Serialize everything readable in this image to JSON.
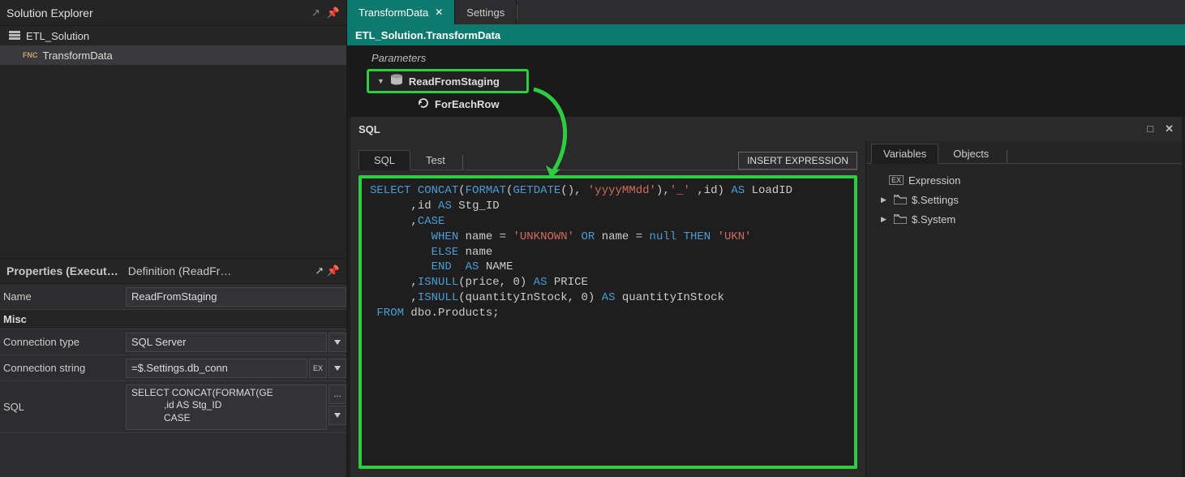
{
  "solutionExplorer": {
    "title": "Solution Explorer",
    "root": {
      "label": "ETL_Solution"
    },
    "item": {
      "badge": "FNC",
      "label": "TransformData"
    }
  },
  "properties": {
    "tab1": "Properties (Execut…",
    "tab2": "Definition (ReadFr…",
    "nameLabel": "Name",
    "nameValue": "ReadFromStaging",
    "catMisc": "Misc",
    "connTypeLabel": "Connection type",
    "connTypeValue": "SQL Server",
    "connStrLabel": "Connection string",
    "connStrValue": "=$.Settings.db_conn",
    "exBtn": "EX",
    "sqlLabel": "SQL",
    "sqlPreview": "SELECT CONCAT(FORMAT(GE\n            ,id AS Stg_ID\n            CASE",
    "ellipsis": "..."
  },
  "tabs": {
    "active": "TransformData",
    "other": "Settings"
  },
  "pathBar": "ETL_Solution.TransformData",
  "crumbs": {
    "params": "Parameters",
    "step1": "ReadFromStaging",
    "sub": "ForEachRow"
  },
  "editor": {
    "title": "SQL",
    "tabSql": "SQL",
    "tabTest": "Test",
    "insertBtn": "INSERT EXPRESSION"
  },
  "code": {
    "l1a": "SELECT",
    "l1b": "CONCAT",
    "l1c": "FORMAT",
    "l1d": "GETDATE",
    "l1e": "'yyyyMMdd'",
    "l1f": "'_'",
    "l1g": "AS",
    "l1h": "LoadID",
    "l2a": ",id",
    "l2b": "AS",
    "l2c": "Stg_ID",
    "l3a": ",",
    "l3b": "CASE",
    "l4a": "WHEN",
    "l4b": "name =",
    "l4c": "'UNKNOWN'",
    "l4d": "OR",
    "l4e": "name =",
    "l4f": "null",
    "l4g": "THEN",
    "l4h": "'UKN'",
    "l5a": "ELSE",
    "l5b": "name",
    "l6a": "END",
    "l6b": "AS",
    "l6c": "NAME",
    "l7a": ",",
    "l7b": "ISNULL",
    "l7c": "(price, 0)",
    "l7d": "AS",
    "l7e": "PRICE",
    "l8a": ",",
    "l8b": "ISNULL",
    "l8c": "(quantityInStock, 0)",
    "l8d": "AS",
    "l8e": "quantityInStock",
    "l9a": "FROM",
    "l9b": "dbo.Products;"
  },
  "vars": {
    "tab1": "Variables",
    "tab2": "Objects",
    "expr": "Expression",
    "exprBadge": "EX",
    "node1": "$.Settings",
    "node2": "$.System"
  }
}
